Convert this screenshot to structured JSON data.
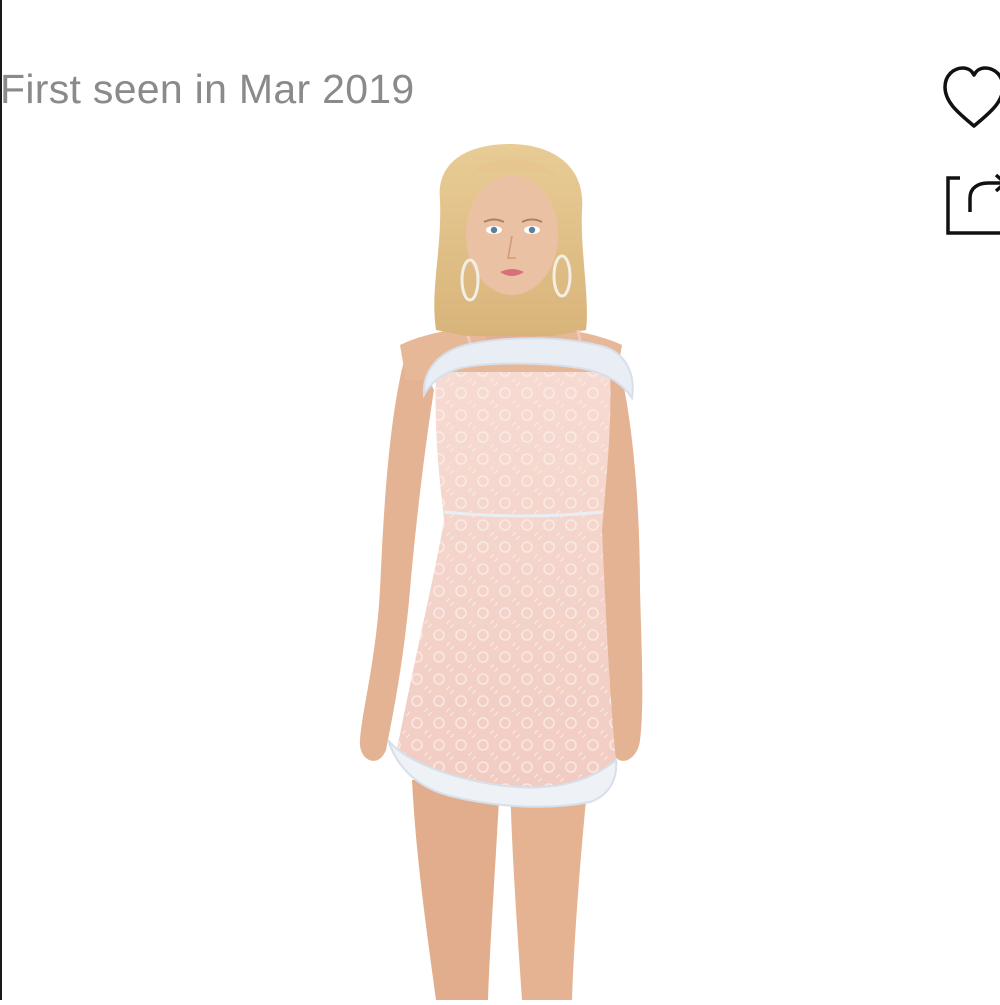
{
  "listing": {
    "first_seen_text": "First seen in Mar 2019"
  },
  "actions": {
    "favorite_icon": "heart-outline-icon",
    "share_icon": "share-arrow-icon"
  },
  "product_image": {
    "subject": "model wearing pink lace mini dress with white ruffle trim",
    "colors": {
      "background": "#ffffff",
      "dress": "#f4d3c9",
      "ruffle": "#e9eef5",
      "skin": "#e4b394",
      "hair": "#e2c48e"
    }
  }
}
